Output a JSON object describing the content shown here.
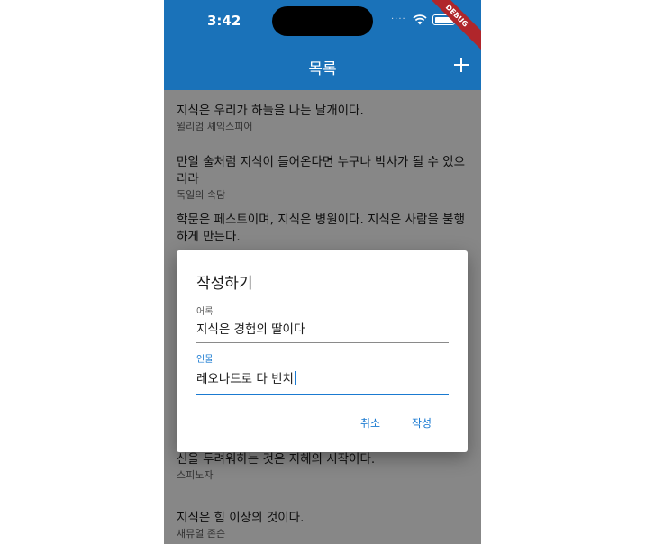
{
  "status_bar": {
    "time": "3:42",
    "signal": "....",
    "debug_banner": "DEBUG"
  },
  "app_bar": {
    "title": "목록",
    "add_icon": "plus-icon"
  },
  "colors": {
    "primary": "#1a72b9",
    "accent": "#1a7ad1",
    "debug": "#b0262b"
  },
  "quotes": [
    {
      "text": "지식은 우리가 하늘을 나는 날개이다.",
      "author": "윌리엄 셰익스피어"
    },
    {
      "text": "만일 술처럼 지식이 들어온다면 누구나 박사가 될 수 있으리라",
      "author": "독일의 속담"
    },
    {
      "text": "학문은 페스트이며, 지식은 병원이다. 지식은 사람을 불행하게 만든다.",
      "author": ""
    },
    {
      "text": "신을 두려워하는 것은 지혜의 시작이다.",
      "author": "스피노자"
    },
    {
      "text": "지식은 힘 이상의 것이다.",
      "author": "새뮤얼 존슨"
    }
  ],
  "dialog": {
    "title": "작성하기",
    "quote_field": {
      "label": "어록",
      "value": "지식은 경험의 딸이다"
    },
    "person_field": {
      "label": "인물",
      "value": "레오나드로 다 빈치"
    },
    "cancel_label": "취소",
    "submit_label": "작성"
  }
}
